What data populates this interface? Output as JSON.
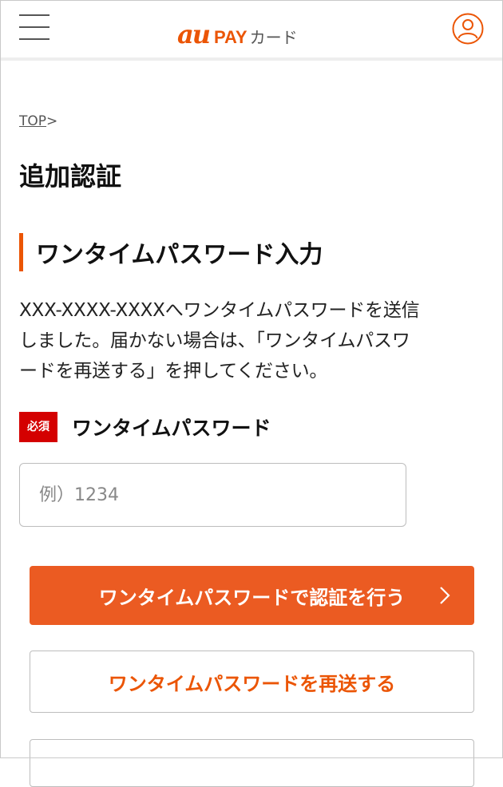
{
  "header": {
    "logo_au": "au",
    "logo_pay": "PAY",
    "logo_card": "カード",
    "menu_icon": "hamburger-menu-icon",
    "user_icon": "user-account-icon"
  },
  "breadcrumb": {
    "top": "TOP",
    "separator": ">"
  },
  "page_title": "追加認証",
  "section_title": "ワンタイムパスワード入力",
  "description_lines": [
    "XXX-XXXX-XXXXへワンタイムパスワードを送信",
    "しました。届かない場合は、「ワンタイムパスワ",
    "ードを再送する」を押してください。"
  ],
  "field": {
    "required_badge": "必須",
    "label": "ワンタイムパスワード",
    "placeholder": "例）1234",
    "value": ""
  },
  "buttons": {
    "authenticate": "ワンタイムパスワードで認証を行う",
    "resend": "ワンタイムパスワードを再送する"
  },
  "colors": {
    "accent": "#eb5505",
    "primary_button": "#eb5b22",
    "required": "#d40000"
  }
}
